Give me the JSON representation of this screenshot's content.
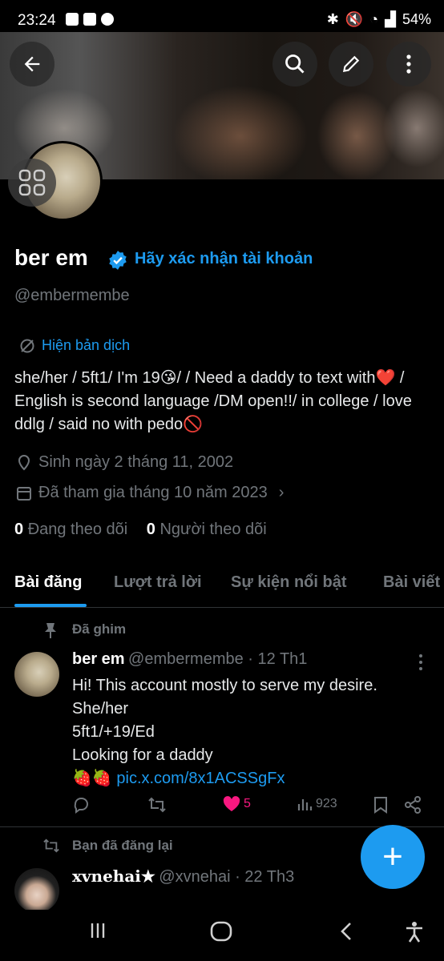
{
  "status_bar": {
    "time": "23:24",
    "battery": "54%"
  },
  "profile": {
    "name": "ber em",
    "verify_link": "Hãy xác nhận tài khoản",
    "handle": "@embermembe",
    "translate": "Hiện bản dịch",
    "bio": "she/her /  5ft1/ I'm 19😘/ /  Need a daddy to text with❤️ /   English is second language /DM open!!/ in college / love ddlg / said no with pedo🚫",
    "birthday": "Sinh ngày 2 tháng 11, 2002",
    "joined": "Đã tham gia tháng 10 năm 2023",
    "following_count": "0",
    "following_label": "Đang theo dõi",
    "followers_count": "0",
    "followers_label": "Người theo dõi"
  },
  "tabs": [
    {
      "label": "Bài đăng"
    },
    {
      "label": "Lượt trả lời"
    },
    {
      "label": "Sự kiện nổi bật"
    },
    {
      "label": "Bài viết"
    }
  ],
  "pinned_tweet": {
    "pinned_label": "Đã ghim",
    "name": "ber em",
    "handle_date": "@embermembe · 12 Th1",
    "line1": "Hi! This account mostly to serve my desire.",
    "line2": "She/her",
    "line3": "5ft1/+19/Ed",
    "line4": "Looking for a daddy",
    "line5_emoji": "🍓🍓",
    "link": "pic.x.com/8x1ACSSgFx",
    "likes": "5",
    "views": "923"
  },
  "repost": {
    "label": "Bạn đã đăng lại",
    "name": "xvnehai★",
    "handle_date": "@xvnehai · 22 Th3"
  },
  "colors": {
    "accent": "#1d9bf0",
    "like": "#f91880",
    "muted": "#71767b"
  }
}
